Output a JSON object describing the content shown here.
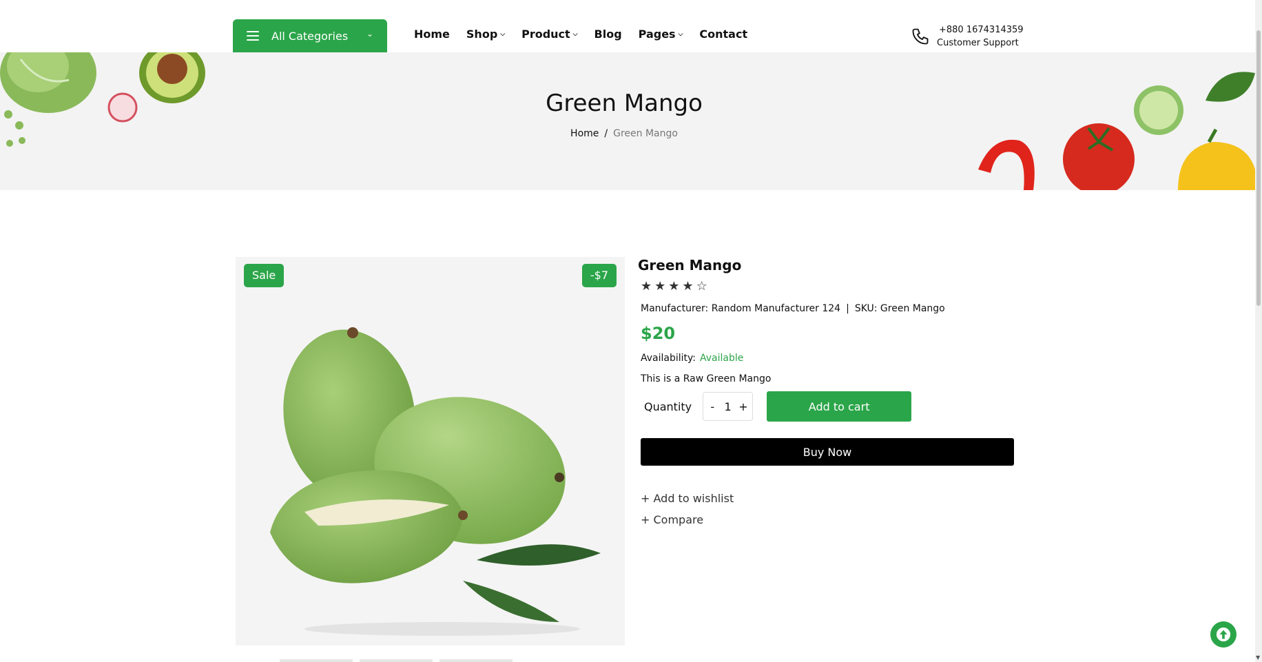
{
  "header": {
    "categories_label": "All Categories",
    "nav": [
      {
        "label": "Home",
        "dropdown": false
      },
      {
        "label": "Shop",
        "dropdown": true
      },
      {
        "label": "Product",
        "dropdown": true
      },
      {
        "label": "Blog",
        "dropdown": false
      },
      {
        "label": "Pages",
        "dropdown": true
      },
      {
        "label": "Contact",
        "dropdown": false
      }
    ],
    "phone_number": "+880 1674314359",
    "phone_caption": "Customer Support"
  },
  "banner": {
    "title": "Green Mango",
    "breadcrumb_home": "Home",
    "breadcrumb_separator": "/",
    "breadcrumb_current": "Green Mango"
  },
  "product": {
    "sale_badge": "Sale",
    "discount_badge": "-$7",
    "title": "Green Mango",
    "rating": 4,
    "rating_max": 5,
    "manufacturer_text": "Manufacturer: Random Manufacturer 124",
    "meta_separator": "|",
    "sku_text": "SKU: Green Mango",
    "price": "$20",
    "availability_label": "Availability:",
    "availability_value": "Available",
    "description": "This is a Raw Green Mango",
    "quantity_label": "Quantity",
    "quantity_minus": "-",
    "quantity_value": "1",
    "quantity_plus": "+",
    "add_to_cart": "Add to cart",
    "buy_now": "Buy Now",
    "wishlist": "+ Add to wishlist",
    "compare": "+ Compare"
  },
  "colors": {
    "accent": "#2ba549",
    "banner_bg": "#f3f3f3"
  }
}
